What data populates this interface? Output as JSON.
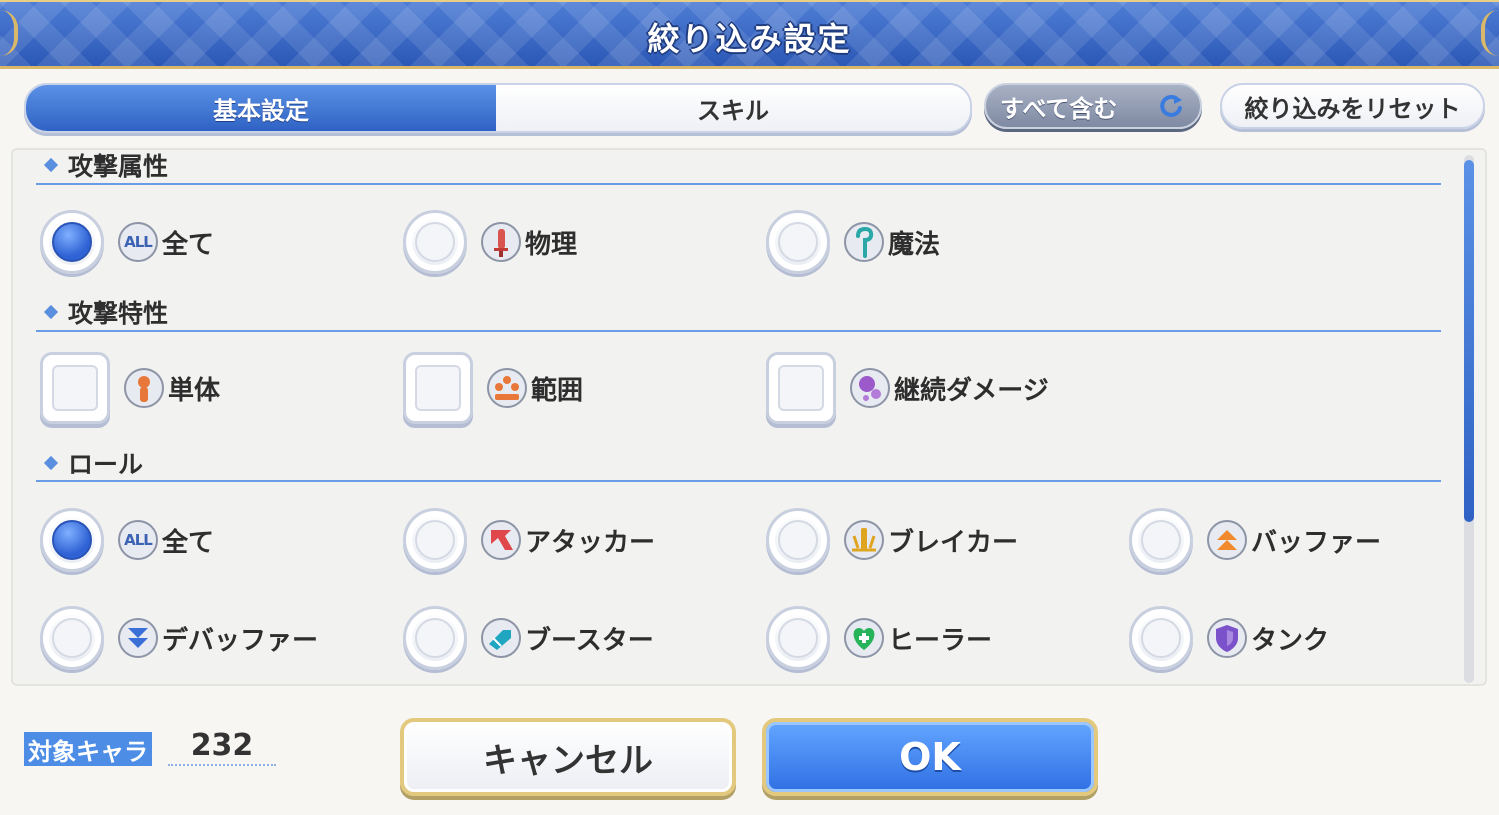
{
  "header": {
    "title": "絞り込み設定"
  },
  "tabs": [
    {
      "label": "基本設定",
      "active": true
    },
    {
      "label": "スキル",
      "active": false
    }
  ],
  "toolbar": {
    "include_all_label": "すべて含む",
    "reset_label": "絞り込みをリセット"
  },
  "sections": {
    "attack_attribute": {
      "title": "攻撃属性",
      "options": [
        {
          "label": "全て",
          "icon": "all-icon",
          "selected": true
        },
        {
          "label": "物理",
          "icon": "physical-sword-icon",
          "selected": false
        },
        {
          "label": "魔法",
          "icon": "magic-staff-icon",
          "selected": false
        }
      ]
    },
    "attack_trait": {
      "title": "攻撃特性",
      "options": [
        {
          "label": "単体",
          "icon": "single-target-icon",
          "checked": false
        },
        {
          "label": "範囲",
          "icon": "area-icon",
          "checked": false
        },
        {
          "label": "継続ダメージ",
          "icon": "damage-over-time-icon",
          "checked": false
        }
      ]
    },
    "role": {
      "title": "ロール",
      "options": [
        {
          "label": "全て",
          "icon": "all-icon",
          "selected": true
        },
        {
          "label": "アタッカー",
          "icon": "attacker-icon",
          "selected": false
        },
        {
          "label": "ブレイカー",
          "icon": "breaker-icon",
          "selected": false
        },
        {
          "label": "バッファー",
          "icon": "buffer-icon",
          "selected": false
        },
        {
          "label": "デバッファー",
          "icon": "debuffer-icon",
          "selected": false
        },
        {
          "label": "ブースター",
          "icon": "booster-icon",
          "selected": false
        },
        {
          "label": "ヒーラー",
          "icon": "healer-icon",
          "selected": false
        },
        {
          "label": "タンク",
          "icon": "tank-icon",
          "selected": false
        }
      ]
    }
  },
  "all_badge_text": "ALL",
  "footer": {
    "count_label": "対象キャラ",
    "count_value": "232",
    "cancel_label": "キャンセル",
    "ok_label": "OK"
  },
  "colors": {
    "accent_blue": "#2f62c4",
    "gold_border": "#e3c97d",
    "panel_bg": "#f2f2f0"
  }
}
